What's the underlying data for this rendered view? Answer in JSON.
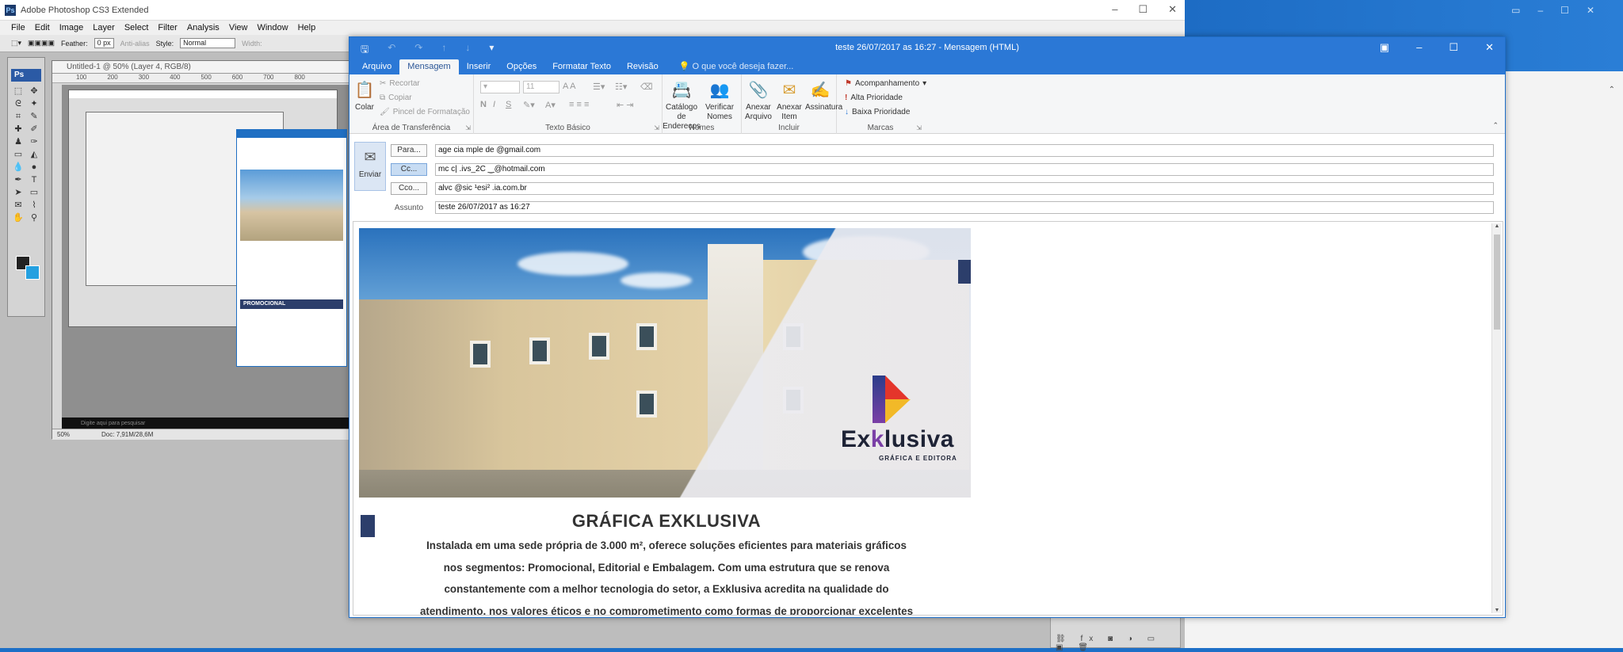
{
  "photoshop": {
    "title": "Adobe Photoshop CS3 Extended",
    "menu": [
      "File",
      "Edit",
      "Image",
      "Layer",
      "Select",
      "Filter",
      "Analysis",
      "View",
      "Window",
      "Help"
    ],
    "options": {
      "feather_label": "Feather:",
      "feather_value": "0 px",
      "antialias_label": "Anti-alias",
      "style_label": "Style:",
      "style_value": "Normal",
      "width_label": "Width:"
    },
    "toolbox_tab": "Ps",
    "document": {
      "title": "Untitled-1 @ 50% (Layer 4, RGB/8)",
      "ruler": [
        "100",
        "200",
        "300",
        "400",
        "500",
        "600",
        "700",
        "800"
      ],
      "zoom": "50%",
      "doc_size": "Doc: 7,91M/28,6M",
      "promo_label": "PROMOCIONAL",
      "search_placeholder": "Digite aqui para pesquisar"
    }
  },
  "outlook": {
    "window_title": "teste 26/07/2017 as 16:27 - Mensagem (HTML)",
    "tabs": [
      "Arquivo",
      "Mensagem",
      "Inserir",
      "Opções",
      "Formatar Texto",
      "Revisão"
    ],
    "active_tab": "Mensagem",
    "tell_me": "O que você deseja fazer...",
    "ribbon": {
      "clipboard": {
        "paste": "Colar",
        "cut": "Recortar",
        "copy": "Copiar",
        "format_painter": "Pincel de Formatação",
        "label": "Área de Transferência"
      },
      "basic_text": {
        "font_size": "11",
        "label": "Texto Básico"
      },
      "names": {
        "address_book": "Catálogo de Endereços",
        "check_names": "Verificar Nomes",
        "label": "Nomes"
      },
      "include": {
        "attach_file": "Anexar Arquivo",
        "attach_item": "Anexar Item",
        "signature": "Assinatura",
        "label": "Incluir"
      },
      "tags": {
        "follow_up": "Acompanhamento",
        "high_priority": "Alta Prioridade",
        "low_priority": "Baixa Prioridade",
        "label": "Marcas"
      }
    },
    "compose": {
      "send": "Enviar",
      "to_label": "Para...",
      "to_value": "age  cia  mple  de  @gmail.com",
      "cc_label": "Cc...",
      "cc_value": "mc  c|  .ivs_2C  ‿@hotmail.com",
      "bcc_label": "Cco...",
      "bcc_value": "alvc  @sic  ¹esi²  .ia.com.br",
      "subject_label": "Assunto",
      "subject_value": "teste 26/07/2017 as 16:27"
    },
    "email_body": {
      "brand": "Exklusiva",
      "brand_tagline": "GRÁFICA E EDITORA",
      "heading": "GRÁFICA EXKLUSIVA",
      "paragraph_lines": [
        "Instalada em uma sede própria de 3.000 m², oferece soluções eficientes para materiais gráficos",
        "nos segmentos: Promocional, Editorial e Embalagem. Com uma estrutura que se renova",
        "constantemente com a melhor tecnologia do setor, a Exklusiva acredita na qualidade do",
        "atendimento, nos valores éticos e no comprometimento como formas de proporcionar excelentes"
      ]
    }
  },
  "colors": {
    "outlook_blue": "#2b78d6",
    "brand_navy": "#2c3e6b"
  }
}
